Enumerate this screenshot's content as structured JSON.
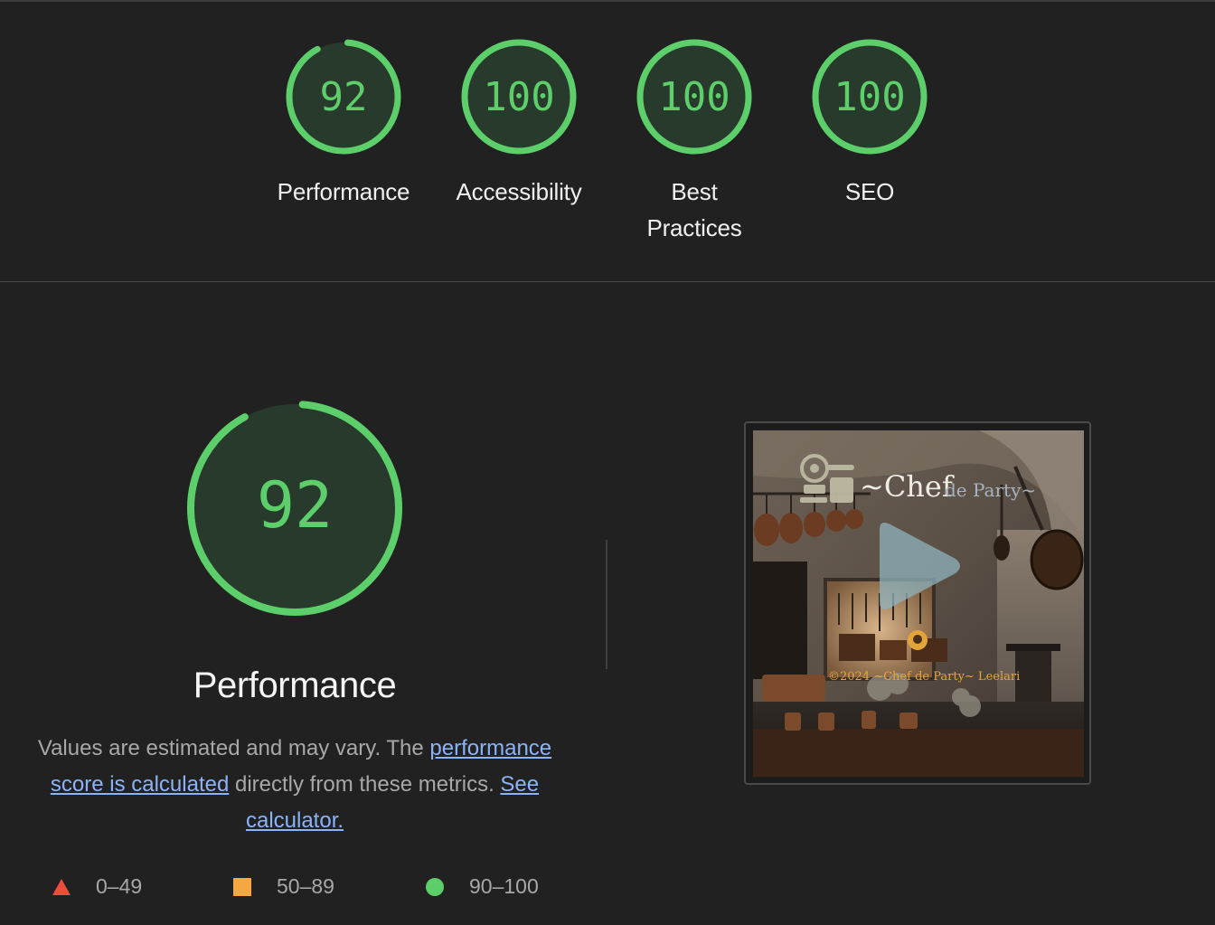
{
  "summary": {
    "gauges": [
      {
        "label": "Performance",
        "score": "92",
        "fraction": 0.92
      },
      {
        "label": "Accessibility",
        "score": "100",
        "fraction": 1.0
      },
      {
        "label": "Best Practices",
        "score": "100",
        "fraction": 1.0
      },
      {
        "label": "SEO",
        "score": "100",
        "fraction": 1.0
      }
    ]
  },
  "performance": {
    "score": "92",
    "fraction": 0.92,
    "title": "Performance",
    "desc_prefix": "Values are estimated and may vary. The ",
    "desc_link1": "performance score is calculated",
    "desc_middle": " directly from these metrics. ",
    "desc_link2": "See calculator."
  },
  "screenshot": {
    "logo_main": "~Chef",
    "logo_sub": "de Party~",
    "footer": "©2024 ~Chef de Party~ Leelari"
  },
  "legend": [
    {
      "range": "0–49",
      "shape": "triangle-icon",
      "color": "#ed4d3d"
    },
    {
      "range": "50–89",
      "shape": "square-icon",
      "color": "#f5a742"
    },
    {
      "range": "90–100",
      "shape": "circle-icon",
      "color": "#5ccf6b"
    }
  ],
  "colors": {
    "pass": "#5ccf6b",
    "pass_bg": "#283a2b",
    "background": "#212121",
    "link": "#8ab4f8"
  }
}
